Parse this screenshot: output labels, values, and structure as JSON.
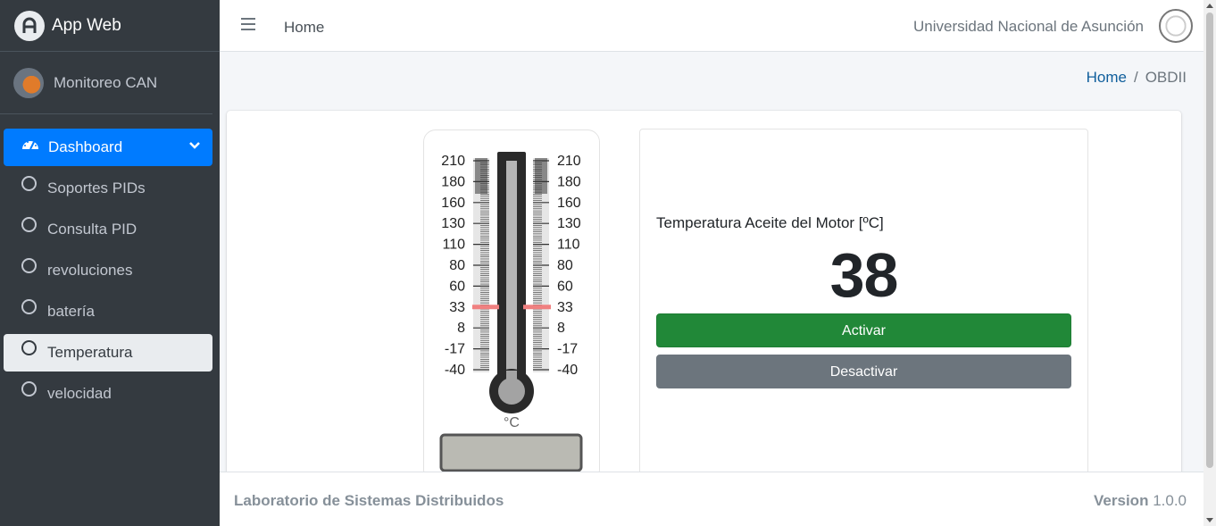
{
  "brand": {
    "name": "App Web",
    "logo_icon": "app-logo-icon"
  },
  "user": {
    "name": "Monitoreo CAN"
  },
  "sidebar": {
    "items": [
      {
        "label": "Dashboard",
        "icon": "dashboard-icon",
        "state": "active"
      },
      {
        "label": "Soportes PIDs",
        "icon": "circle-icon"
      },
      {
        "label": "Consulta PID",
        "icon": "circle-icon"
      },
      {
        "label": "revoluciones",
        "icon": "circle-icon"
      },
      {
        "label": "batería",
        "icon": "circle-icon"
      },
      {
        "label": "Temperatura",
        "icon": "circle-icon",
        "state": "selected"
      },
      {
        "label": "velocidad",
        "icon": "circle-icon"
      }
    ]
  },
  "topbar": {
    "home": "Home",
    "university": "Universidad Nacional de Asunción"
  },
  "breadcrumb": {
    "home": "Home",
    "separator": "/",
    "current": "OBDII"
  },
  "thermometer": {
    "scale": [
      "210",
      "180",
      "160",
      "130",
      "110",
      "80",
      "60",
      "33",
      "8",
      "-17",
      "-40"
    ],
    "unit": "°C",
    "reading": 33,
    "range": [
      -40,
      210
    ]
  },
  "sensor": {
    "title": "Temperatura Aceite del Motor [ºC]",
    "value": "38",
    "activate_label": "Activar",
    "deactivate_label": "Desactivar"
  },
  "footer": {
    "lab": "Laboratorio de Sistemas Distribuidos",
    "version_label": "Version",
    "version": "1.0.0"
  },
  "colors": {
    "primary": "#007bff",
    "success": "#218838",
    "secondary": "#6c757d",
    "sidebar": "#343a40",
    "mercury_marker": "#f08080"
  }
}
